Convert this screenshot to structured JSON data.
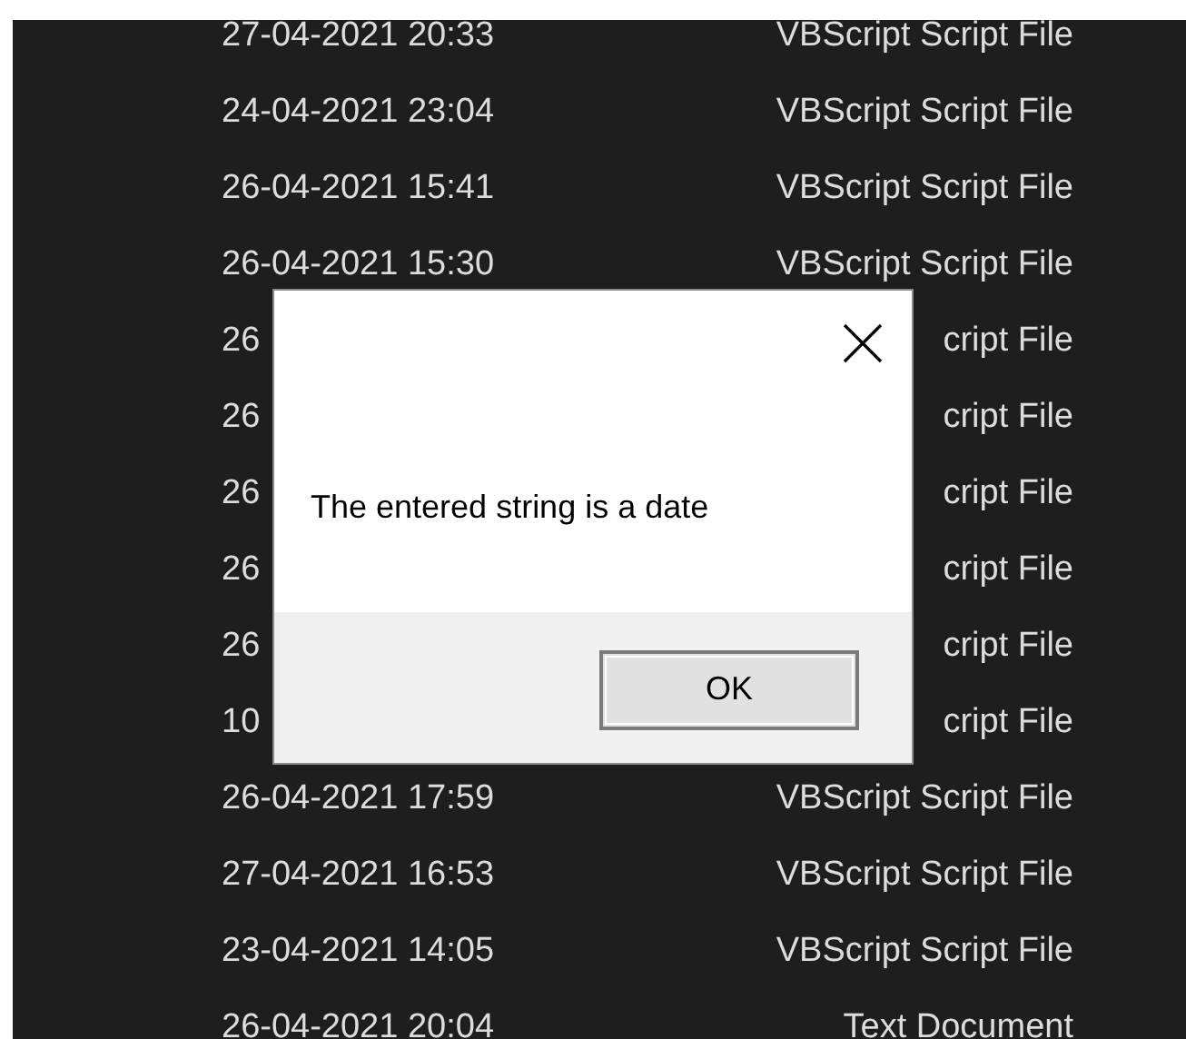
{
  "file_list": {
    "rows": [
      {
        "date_modified": "27-04-2021 20:33",
        "type": "VBScript Script File"
      },
      {
        "date_modified": "24-04-2021 23:04",
        "type": "VBScript Script File"
      },
      {
        "date_modified": "26-04-2021 15:41",
        "type": "VBScript Script File"
      },
      {
        "date_modified": "26-04-2021 15:30",
        "type": "VBScript Script File"
      },
      {
        "date_modified": "26",
        "type": "cript File"
      },
      {
        "date_modified": "26",
        "type": "cript File"
      },
      {
        "date_modified": "26",
        "type": "cript File"
      },
      {
        "date_modified": "26",
        "type": "cript File"
      },
      {
        "date_modified": "26",
        "type": "cript File"
      },
      {
        "date_modified": "10",
        "type": "cript File"
      },
      {
        "date_modified": "26-04-2021 17:59",
        "type": "VBScript Script File"
      },
      {
        "date_modified": "27-04-2021 16:53",
        "type": "VBScript Script File"
      },
      {
        "date_modified": "23-04-2021 14:05",
        "type": "VBScript Script File"
      },
      {
        "date_modified": "26-04-2021 20:04",
        "type": "Text Document"
      }
    ]
  },
  "dialog": {
    "message": "The entered string is a date",
    "ok_button": {
      "label": "OK"
    }
  }
}
